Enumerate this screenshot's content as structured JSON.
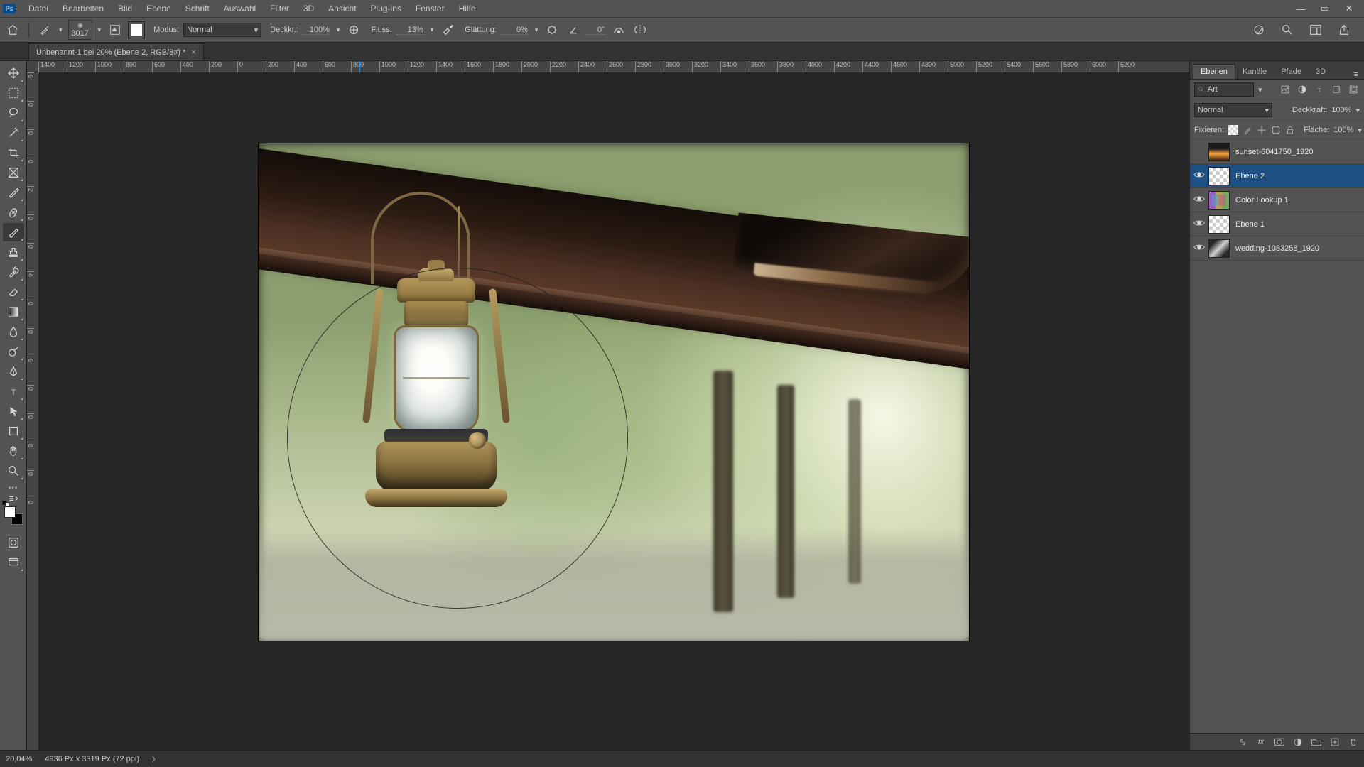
{
  "menu": {
    "items": [
      "Datei",
      "Bearbeiten",
      "Bild",
      "Ebene",
      "Schrift",
      "Auswahl",
      "Filter",
      "3D",
      "Ansicht",
      "Plug-ins",
      "Fenster",
      "Hilfe"
    ]
  },
  "options": {
    "brush_size": "3017",
    "modus_label": "Modus:",
    "modus_value": "Normal",
    "deckkr_label": "Deckkr.:",
    "deckkr_value": "100%",
    "fluss_label": "Fluss:",
    "fluss_value": "13%",
    "glaettung_label": "Glättung:",
    "glaettung_value": "0%",
    "angle_value": "0°"
  },
  "document": {
    "tab_title": "Unbenannt-1 bei 20% (Ebene 2, RGB/8#) *"
  },
  "ruler_h": [
    "1400",
    "1200",
    "1000",
    "800",
    "600",
    "400",
    "200",
    "0",
    "200",
    "400",
    "600",
    "800",
    "1000",
    "1200",
    "1400",
    "1600",
    "1800",
    "2000",
    "2200",
    "2400",
    "2600",
    "2800",
    "3000",
    "3200",
    "3400",
    "3600",
    "3800",
    "4000",
    "4200",
    "4400",
    "4600",
    "4800",
    "5000",
    "5200",
    "5400",
    "5600",
    "5800",
    "6000",
    "6200"
  ],
  "ruler_marker_h_label": "1400",
  "ruler_v": [
    "6",
    "0",
    "0",
    "0",
    "2",
    "0",
    "0",
    "4",
    "0",
    "0",
    "6",
    "0",
    "0",
    "8",
    "0",
    "0"
  ],
  "panels": {
    "tabs": [
      "Ebenen",
      "Kanäle",
      "Pfade",
      "3D"
    ],
    "active_tab": "Ebenen",
    "layer_kind_label": "Art",
    "blend_mode": "Normal",
    "opacity_label": "Deckkraft:",
    "opacity_value": "100%",
    "fix_label": "Fixieren:",
    "fill_label": "Fläche:",
    "fill_value": "100%"
  },
  "layers": [
    {
      "name": "sunset-6041750_1920",
      "visible": false,
      "thumb": "sunset",
      "selected": false
    },
    {
      "name": "Ebene 2",
      "visible": true,
      "thumb": "checker",
      "selected": true
    },
    {
      "name": "Color Lookup 1",
      "visible": true,
      "thumb": "lookup",
      "selected": false
    },
    {
      "name": "Ebene 1",
      "visible": true,
      "thumb": "checker",
      "selected": false
    },
    {
      "name": "wedding-1083258_1920",
      "visible": true,
      "thumb": "wedding",
      "selected": false
    }
  ],
  "status": {
    "zoom": "20,04%",
    "doc_dims": "4936 Px x 3319 Px (72 ppi)"
  }
}
